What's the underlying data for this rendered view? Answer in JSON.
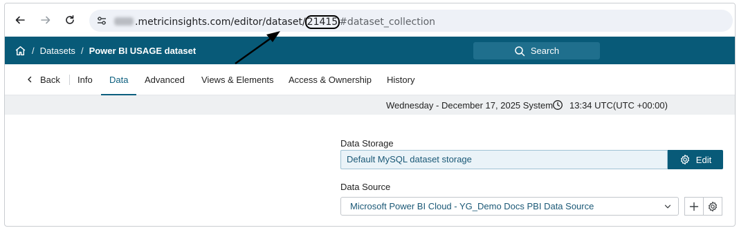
{
  "browser": {
    "url_domain": ".metricinsights.com/editor/dataset/",
    "url_id": "21415",
    "url_hash": "#dataset_collection"
  },
  "header": {
    "breadcrumbs": [
      "Datasets",
      "Power BI USAGE dataset"
    ],
    "breadcrumb_separator": "/",
    "search_label": "Search",
    "accent_color": "#085a78"
  },
  "tabs": {
    "back_label": "Back",
    "items": [
      "Info",
      "Data",
      "Advanced",
      "Views & Elements",
      "Access & Ownership",
      "History"
    ],
    "active": "Data"
  },
  "status": {
    "date_text": "Wednesday - December 17, 2025 System",
    "time_text": "13:34 UTC(UTC +00:00)"
  },
  "form": {
    "data_storage_label": "Data Storage",
    "data_storage_value": "Default MySQL dataset storage",
    "edit_label": "Edit",
    "data_source_label": "Data Source",
    "data_source_value": "Microsoft Power BI Cloud - YG_Demo Docs PBI Data Source"
  },
  "icons": {
    "back": "arrow-left-icon",
    "forward": "arrow-right-icon",
    "reload": "reload-icon",
    "site_settings": "tune-icon",
    "home": "home-icon",
    "search": "search-icon",
    "clock": "clock-icon",
    "gear": "gear-icon",
    "plus": "plus-icon",
    "chevron": "chevron-down-icon"
  }
}
